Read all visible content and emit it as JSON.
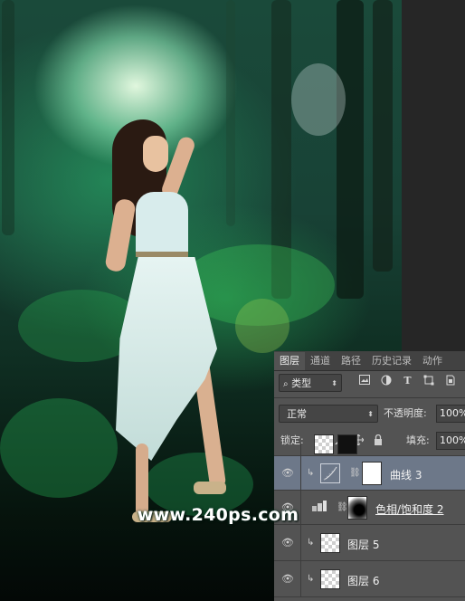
{
  "canvas": {
    "watermark": "www.240ps.com"
  },
  "layers_panel": {
    "tabs": [
      {
        "label": "图层",
        "active": true
      },
      {
        "label": "通道",
        "active": false
      },
      {
        "label": "路径",
        "active": false
      },
      {
        "label": "历史记录",
        "active": false
      },
      {
        "label": "动作",
        "active": false
      }
    ],
    "filter": {
      "kind_label": "类型"
    },
    "blend": {
      "mode": "正常",
      "opacity_label": "不透明度:",
      "opacity_value": "100%"
    },
    "lock": {
      "label": "锁定:",
      "fill_label": "填充:",
      "fill_value": "100%"
    },
    "layers": [
      {
        "name": "曲线 3",
        "type": "curves-adjustment",
        "selected": true,
        "clipped": true,
        "visible": true
      },
      {
        "name": "色相/饱和度 2",
        "type": "hue-saturation-adjustment",
        "selected": false,
        "clipped": false,
        "visible": true
      },
      {
        "name": "图层 5",
        "type": "pixel",
        "selected": false,
        "clipped": true,
        "visible": true
      },
      {
        "name": "图层 6",
        "type": "pixel",
        "selected": false,
        "clipped": true,
        "visible": true
      }
    ]
  },
  "colors": {
    "panel_bg": "#535353",
    "tab_bar": "#424242",
    "selected_layer": "#6d7889",
    "forest_glow": "#c8f5d8"
  }
}
